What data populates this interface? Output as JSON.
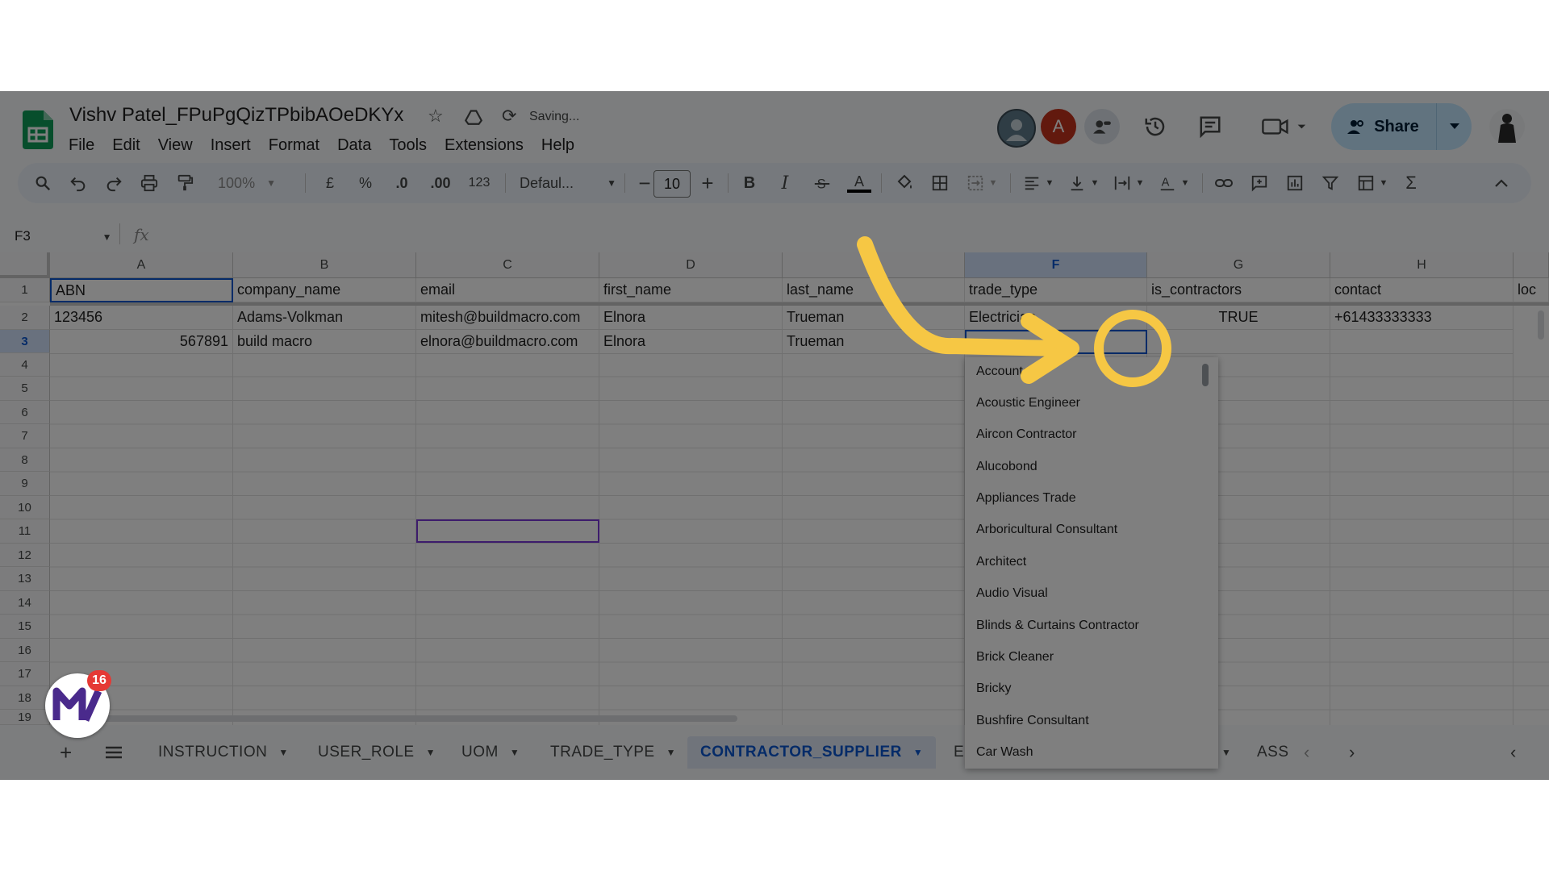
{
  "doc": {
    "title": "Vishv Patel_FPuPgQizTPbibAOeDKYx",
    "saving_status": "Saving..."
  },
  "menu": [
    "File",
    "Edit",
    "View",
    "Insert",
    "Format",
    "Data",
    "Tools",
    "Extensions",
    "Help"
  ],
  "header": {
    "avatar_letter": "A",
    "share_label": "Share"
  },
  "toolbar": {
    "zoom": "100%",
    "currency": "£",
    "percent": "%",
    "decrease_decimal": ".0",
    "increase_decimal": ".00",
    "number_format": "123",
    "font": "Defaul...",
    "font_size": "10",
    "bold": "B",
    "italic": "I",
    "text_color": "A"
  },
  "formula_bar": {
    "cell_ref": "F3",
    "fx": "fx"
  },
  "sheet": {
    "columns": [
      "A",
      "B",
      "C",
      "D",
      "E",
      "F",
      "G",
      "H"
    ],
    "selected_column": "F",
    "rows": [
      "1",
      "2",
      "3",
      "4",
      "5",
      "6",
      "7",
      "8",
      "9",
      "10",
      "11",
      "12",
      "13",
      "14",
      "15",
      "16",
      "17",
      "18",
      "19"
    ],
    "header_row": [
      "ABN",
      "company_name",
      "email",
      "first_name",
      "last_name",
      "trade_type",
      "is_contractors",
      "contact",
      "loc"
    ],
    "row2": [
      "123456",
      "Adams-Volkman",
      "mitesh@buildmacro.com",
      "Elnora",
      "Trueman",
      "Electrician",
      "TRUE",
      "+61433333333"
    ],
    "row3": [
      "567891",
      "build macro",
      "elnora@buildmacro.com",
      "Elnora",
      "Trueman",
      "",
      "",
      ""
    ]
  },
  "dropdown": {
    "options": [
      "Accountant",
      "Acoustic Engineer",
      "Aircon Contractor",
      "Alucobond",
      "Appliances Trade",
      "Arboricultural Consultant",
      "Architect",
      "Audio Visual",
      "Blinds & Curtains Contractor",
      "Brick Cleaner",
      "Bricky",
      "Bushfire Consultant",
      "Car Wash"
    ]
  },
  "tabs": [
    "INSTRUCTION",
    "USER_ROLE",
    "UOM",
    "TRADE_TYPE",
    "CONTRACTOR_SUPPLIER",
    "E",
    "ASS"
  ],
  "active_tab": "CONTRACTOR_SUPPLIER",
  "badge": {
    "count": "16"
  },
  "colors": {
    "accent": "#0b57d0",
    "highlight": "#f6c744",
    "share_bg": "#c2e7ff",
    "sheets_green": "#0f9d58"
  }
}
